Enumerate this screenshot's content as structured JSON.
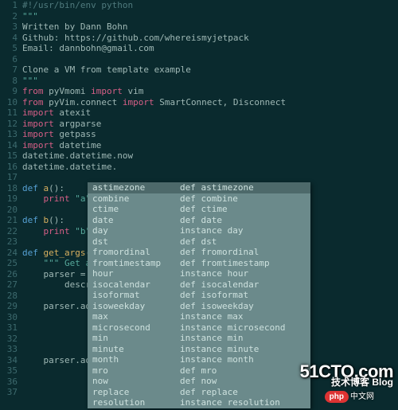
{
  "gutter": {
    "start": 1,
    "end": 37
  },
  "code": {
    "lines": [
      [
        [
          "comment",
          "#!/usr/bin/env python"
        ]
      ],
      [
        [
          "string",
          "\"\"\""
        ]
      ],
      [
        [
          "ident",
          "Written by Dann Bohn"
        ]
      ],
      [
        [
          "ident",
          "Github: https://github.com/whereismyjetpack"
        ]
      ],
      [
        [
          "ident",
          "Email: dannbohn@gmail.com"
        ]
      ],
      [],
      [
        [
          "ident",
          "Clone a VM from template example"
        ]
      ],
      [
        [
          "string",
          "\"\"\""
        ]
      ],
      [
        [
          "keyword",
          "from "
        ],
        [
          "ident",
          "pyVmomi "
        ],
        [
          "keyword",
          "import "
        ],
        [
          "ident",
          "vim"
        ]
      ],
      [
        [
          "keyword",
          "from "
        ],
        [
          "ident",
          "pyVim.connect "
        ],
        [
          "keyword",
          "import "
        ],
        [
          "ident",
          "SmartConnect, Disconnect"
        ]
      ],
      [
        [
          "keyword",
          "import "
        ],
        [
          "ident",
          "atexit"
        ]
      ],
      [
        [
          "keyword",
          "import "
        ],
        [
          "ident",
          "argparse"
        ]
      ],
      [
        [
          "keyword",
          "import "
        ],
        [
          "ident",
          "getpass"
        ]
      ],
      [
        [
          "keyword",
          "import "
        ],
        [
          "ident",
          "datetime"
        ]
      ],
      [
        [
          "ident",
          "datetime.datetime.now"
        ]
      ],
      [
        [
          "ident",
          "datetime.datetime."
        ]
      ],
      [],
      [
        [
          "def",
          "def "
        ],
        [
          "funcname",
          "a"
        ],
        [
          "ident",
          "():"
        ]
      ],
      [
        [
          "ident",
          "    "
        ],
        [
          "keyword",
          "print "
        ],
        [
          "string",
          "\"a\""
        ]
      ],
      [],
      [
        [
          "def",
          "def "
        ],
        [
          "funcname",
          "b"
        ],
        [
          "ident",
          "():"
        ]
      ],
      [
        [
          "ident",
          "    "
        ],
        [
          "keyword",
          "print "
        ],
        [
          "string",
          "\"b\""
        ]
      ],
      [],
      [
        [
          "def",
          "def "
        ],
        [
          "funcname",
          "get_args"
        ],
        [
          "ident",
          "():"
        ]
      ],
      [
        [
          "ident",
          "    "
        ],
        [
          "string",
          "\"\"\" Get argum"
        ]
      ],
      [
        [
          "ident",
          "    parser = argp"
        ]
      ],
      [
        [
          "ident",
          "        descripti"
        ]
      ],
      [],
      [
        [
          "ident",
          "    parser.add_ar"
        ]
      ],
      [],
      [],
      [],
      [],
      [
        [
          "ident",
          "    parser.add_ar"
        ]
      ],
      [],
      [],
      []
    ]
  },
  "completion": {
    "selectedIndex": 0,
    "items": [
      {
        "word": "astimezone",
        "kind": "def astimezone"
      },
      {
        "word": "combine",
        "kind": "def combine"
      },
      {
        "word": "ctime",
        "kind": "def ctime"
      },
      {
        "word": "date",
        "kind": "def date"
      },
      {
        "word": "day",
        "kind": "instance day"
      },
      {
        "word": "dst",
        "kind": "def dst"
      },
      {
        "word": "fromordinal",
        "kind": "def fromordinal"
      },
      {
        "word": "fromtimestamp",
        "kind": "def fromtimestamp"
      },
      {
        "word": "hour",
        "kind": "instance hour"
      },
      {
        "word": "isocalendar",
        "kind": "def isocalendar"
      },
      {
        "word": "isoformat",
        "kind": "def isoformat"
      },
      {
        "word": "isoweekday",
        "kind": "def isoweekday"
      },
      {
        "word": "max",
        "kind": "instance max"
      },
      {
        "word": "microsecond",
        "kind": "instance microsecond"
      },
      {
        "word": "min",
        "kind": "instance min"
      },
      {
        "word": "minute",
        "kind": "instance minute"
      },
      {
        "word": "month",
        "kind": "instance month"
      },
      {
        "word": "mro",
        "kind": "def mro"
      },
      {
        "word": "now",
        "kind": "def now"
      },
      {
        "word": "replace",
        "kind": "def replace"
      },
      {
        "word": "resolution",
        "kind": "instance resolution"
      }
    ]
  },
  "watermark": {
    "big": "51CTO.com",
    "small": "技术博客 Blog"
  },
  "badge": {
    "pill": "php",
    "cn": "中文网"
  }
}
